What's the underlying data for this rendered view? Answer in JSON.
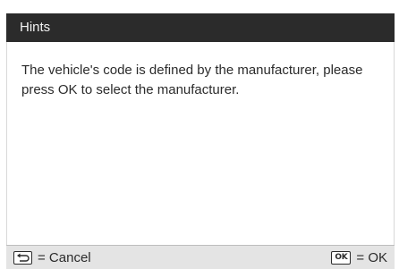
{
  "dialog": {
    "title": "Hints",
    "message": "The vehicle's code is defined by the manufacturer, please press OK to select the manufacturer."
  },
  "footer": {
    "cancel_label": "= Cancel",
    "ok_key": "OK",
    "ok_label": "= OK",
    "cancel_icon": "back-arrow-icon"
  }
}
